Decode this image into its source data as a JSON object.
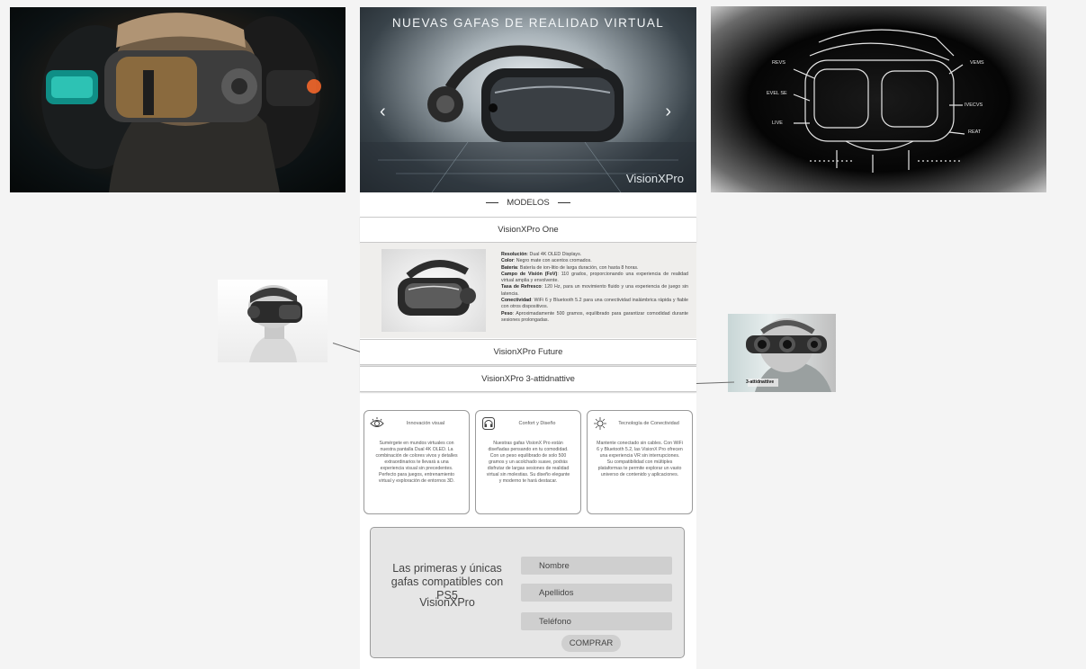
{
  "hero": {
    "title": "NUEVAS GAFAS DE REALIDAD VIRTUAL",
    "brand": "VisionXPro",
    "prev_icon": "chevron-left-icon",
    "next_icon": "chevron-right-icon"
  },
  "models_section": {
    "title": "MODELOS"
  },
  "models": [
    {
      "name": "VisionXPro One"
    },
    {
      "name": "VisionXPro Future"
    },
    {
      "name": "VisionXPro 3-attidnattive"
    }
  ],
  "specs": [
    {
      "label": "Resolución",
      "value": ": Dual 4K OLED Displays."
    },
    {
      "label": "Color",
      "value": ": Negro mate con acentos cromados."
    },
    {
      "label": "Batería",
      "value": ": Batería de ion-litio de larga duración, con hasta 8 horas."
    },
    {
      "label": "Campo de Visión (FoV)",
      "value": ": 110 grados, proporcionando una experiencia de realidad virtual amplia y envolvente."
    },
    {
      "label": "Tasa de Refresco",
      "value": ": 120 Hz, para un movimiento fluido y una experiencia de juego sin latencia."
    },
    {
      "label": "Conectividad",
      "value": ": WiFi 6 y Bluetooth 5.2 para una conectividad inalámbrica rápida y fiable con otros dispositivos."
    },
    {
      "label": "Peso",
      "value": ": Aproximadamente 500 gramos, equilibrado para garantizar comodidad durante sesiones prolongadas."
    }
  ],
  "features": [
    {
      "icon": "eye-icon",
      "title": "Innovación visual",
      "text": "Sumérgete en mundos virtuales con nuestra pantalla Dual 4K OLED. La combinación de colores vivos y detalles extraordinarios te llevará a una experiencia visual sin precedentes. Perfecto para juegos, entrenamiento virtual y exploración de entornos 3D."
    },
    {
      "icon": "headset-icon",
      "title": "Confort y Diseño",
      "text": "Nuestras gafas VisionX Pro están diseñadas pensando en tu comodidad. Con un peso equilibrado de solo 500 gramos y un acolchado suave, podrás disfrutar de largas sesiones de realidad virtual sin molestias. Su diseño elegante y moderno te hará destacar."
    },
    {
      "icon": "connectivity-icon",
      "title": "Tecnología de Conectividad",
      "text": "Mantente conectado sin cables. Con WiFi 6 y Bluetooth 5.2, las VisionX Pro ofrecen una experiencia VR sin interrupciones. Su compatibilidad con múltiples plataformas te permite explorar un vasto universo de contenido y aplicaciones."
    }
  ],
  "purchase": {
    "promo": "Las primeras y únicas gafas compatibles con PS5",
    "brand": "VisionXPro",
    "fields": {
      "name": "Nombre",
      "surname": "Apellidos",
      "phone": "Teléfono"
    },
    "button": "COMPRAR"
  },
  "diagram_labels": [
    "REVS",
    "EVEL SE",
    "LIVE",
    "VEMS",
    "IVECVS",
    "REAT"
  ],
  "side_label": "3-attidnattive"
}
